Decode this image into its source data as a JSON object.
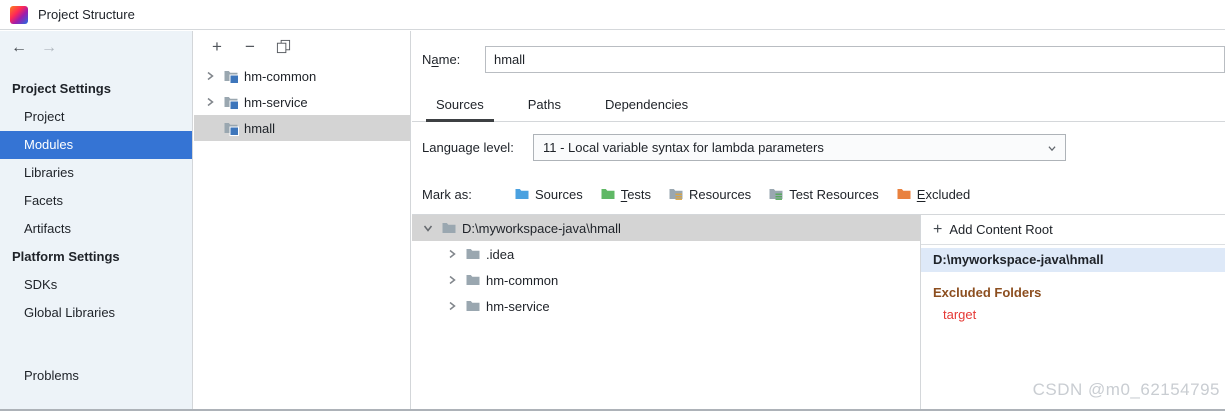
{
  "window": {
    "title": "Project Structure"
  },
  "icons": {
    "back": "←",
    "forward": "→",
    "add": "+",
    "remove": "−"
  },
  "colors": {
    "sidebar_background": "#EDF3F8",
    "sidebar_selection": "#3574D4",
    "tree_selection": "#D4D4D4",
    "content_root_highlight": "#DEE9F8",
    "excluded_header_text": "#8C4E1F",
    "excluded_item_text": "#E53935",
    "sources_folder": "#4AA1E0",
    "tests_folder": "#5FB865",
    "excluded_folder": "#E9813E"
  },
  "sidebar": {
    "header_project_settings": "Project Settings",
    "items_project_settings": [
      "Project",
      "Modules",
      "Libraries",
      "Facets",
      "Artifacts"
    ],
    "header_platform_settings": "Platform Settings",
    "items_platform_settings": [
      "SDKs",
      "Global Libraries"
    ],
    "problems": "Problems",
    "selected_item": "Modules"
  },
  "modules": {
    "items": [
      "hm-common",
      "hm-service",
      "hmall"
    ],
    "selected_item": "hmall"
  },
  "editor": {
    "name_label": "Name:",
    "name_mnemonic": "a",
    "name_value": "hmall",
    "tabs": [
      "Sources",
      "Paths",
      "Dependencies"
    ],
    "selected_tab": "Sources",
    "language_level_label": "Language level:",
    "language_level_value": "11 - Local variable syntax for lambda parameters",
    "mark_as_label": "Mark as:",
    "mark_buttons": [
      "Sources",
      "Tests",
      "Resources",
      "Test Resources",
      "Excluded"
    ],
    "mark_mnemonics": {
      "tests": "T",
      "excluded": "E"
    }
  },
  "content": {
    "root": "D:\\myworkspace-java\\hmall",
    "root_expanded": true,
    "root_selected": true,
    "children": [
      ".idea",
      "hm-common",
      "hm-service"
    ]
  },
  "roots_panel": {
    "add_label": "Add Content Root",
    "root_path": "D:\\myworkspace-java\\hmall",
    "excluded_header": "Excluded Folders",
    "excluded_items": [
      "target"
    ]
  },
  "watermark": "CSDN @m0_62154795"
}
